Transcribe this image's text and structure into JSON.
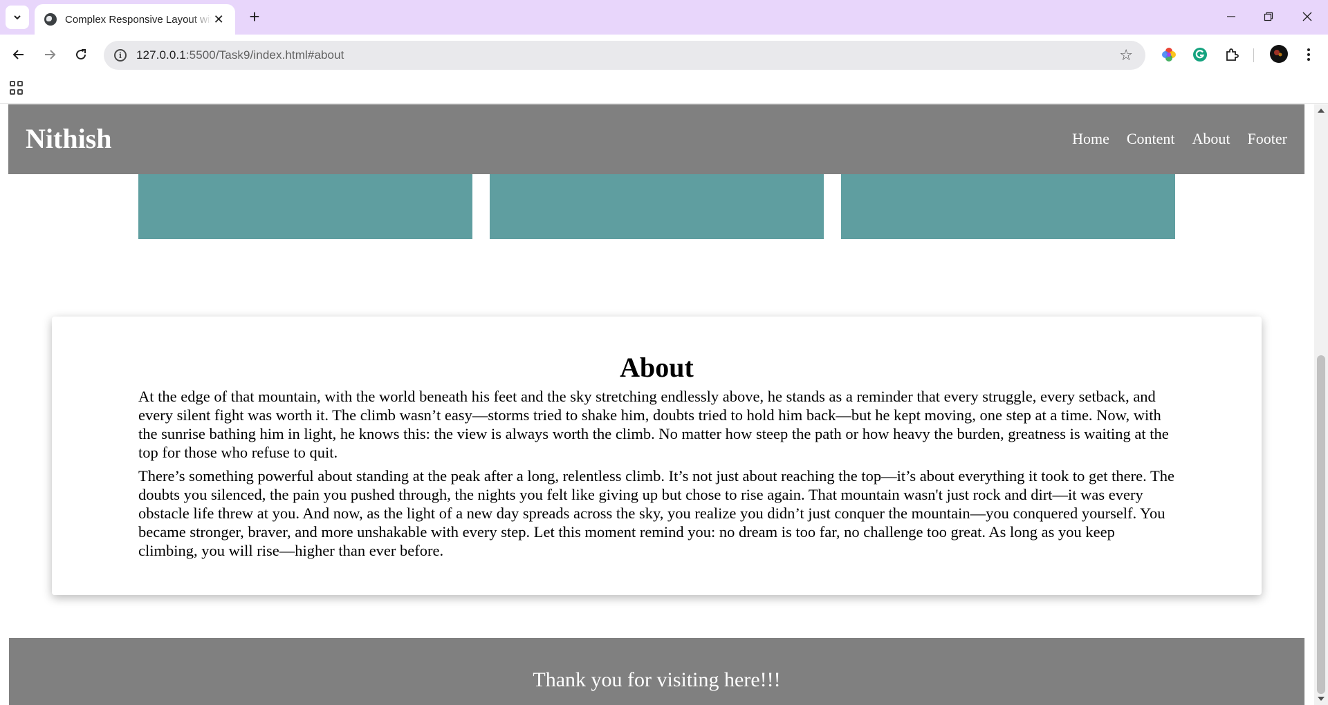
{
  "browser": {
    "tab_title": "Complex Responsive Layout with",
    "url_host": "127.0.0.1",
    "url_path": ":5500/Task9/index.html#about",
    "tabstrip_color": "#e8d6fb"
  },
  "page": {
    "logo": "Nithish",
    "nav": [
      "Home",
      "Content",
      "About",
      "Footer"
    ],
    "about_title": "About",
    "about_paragraphs": [
      "At the edge of that mountain, with the world beneath his feet and the sky stretching endlessly above, he stands as a reminder that every struggle, every setback, and every silent fight was worth it. The climb wasn’t easy—storms tried to shake him, doubts tried to hold him back—but he kept moving, one step at a time. Now, with the sunrise bathing him in light, he knows this: the view is always worth the climb. No matter how steep the path or how heavy the burden, greatness is waiting at the top for those who refuse to quit.",
      "There’s something powerful about standing at the peak after a long, relentless climb. It’s not just about reaching the top—it’s about everything it took to get there. The doubts you silenced, the pain you pushed through, the nights you felt like giving up but chose to rise again. That mountain wasn't just rock and dirt—it was every obstacle life threw at you. And now, as the light of a new day spreads across the sky, you realize you didn’t just conquer the mountain—you conquered yourself. You became stronger, braver, and more unshakable with every step. Let this moment remind you: no dream is too far, no challenge too great. As long as you keep climbing, you will rise—higher than ever before."
    ],
    "footer_text": "Thank you for visiting here!!!",
    "colors": {
      "header": "#808080",
      "card": "#5f9ea0",
      "footer": "#808080"
    }
  }
}
